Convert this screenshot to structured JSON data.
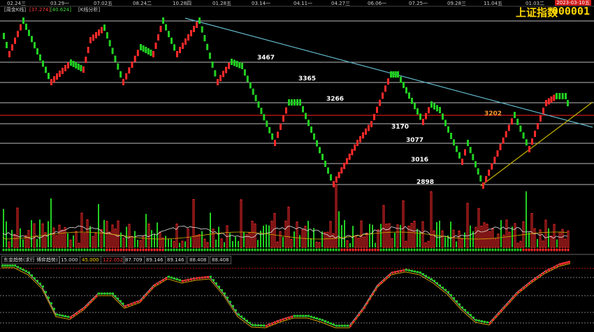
{
  "header": {
    "tabs": [
      {
        "label": "[周金K线]",
        "color": "grey"
      },
      {
        "label": "[37.274]",
        "color": "red"
      },
      {
        "label": "[40.624]",
        "color": "green"
      },
      {
        "label": "[K线分析]",
        "color": "grey"
      }
    ],
    "dates": [
      "02.24三",
      "03.29一",
      "07.02五",
      "08.24二",
      "10.28四",
      "01.28五",
      "03.14一",
      "04.11一",
      "04.27三",
      "06.06一",
      "07.25一",
      "09.28三",
      "11.04五",
      "01.03二"
    ],
    "index_name": "上证指数",
    "index_code": "000001",
    "date_badge": "2023-03-10五"
  },
  "levels": [
    {
      "label": "3467",
      "color": "white"
    },
    {
      "label": "3365",
      "color": "white"
    },
    {
      "label": "3266",
      "color": "white"
    },
    {
      "label": "3202",
      "color": "orange"
    },
    {
      "label": "3170",
      "color": "white"
    },
    {
      "label": "3077",
      "color": "white"
    },
    {
      "label": "3016",
      "color": "white"
    },
    {
      "label": "2898",
      "color": "white"
    }
  ],
  "indicator": {
    "name": "东金趋势(求行 博弈趋势)",
    "values": [
      "15.000",
      "45.000",
      "122.052",
      "87.709",
      "89.146",
      "89.146",
      "88.408",
      "88.408"
    ]
  },
  "colors": {
    "up": "#ff2a2a",
    "down": "#22d022",
    "trend_cyan": "#5fb7c8",
    "trend_yellow": "#c8b400",
    "key_level": "#ff2020"
  }
}
